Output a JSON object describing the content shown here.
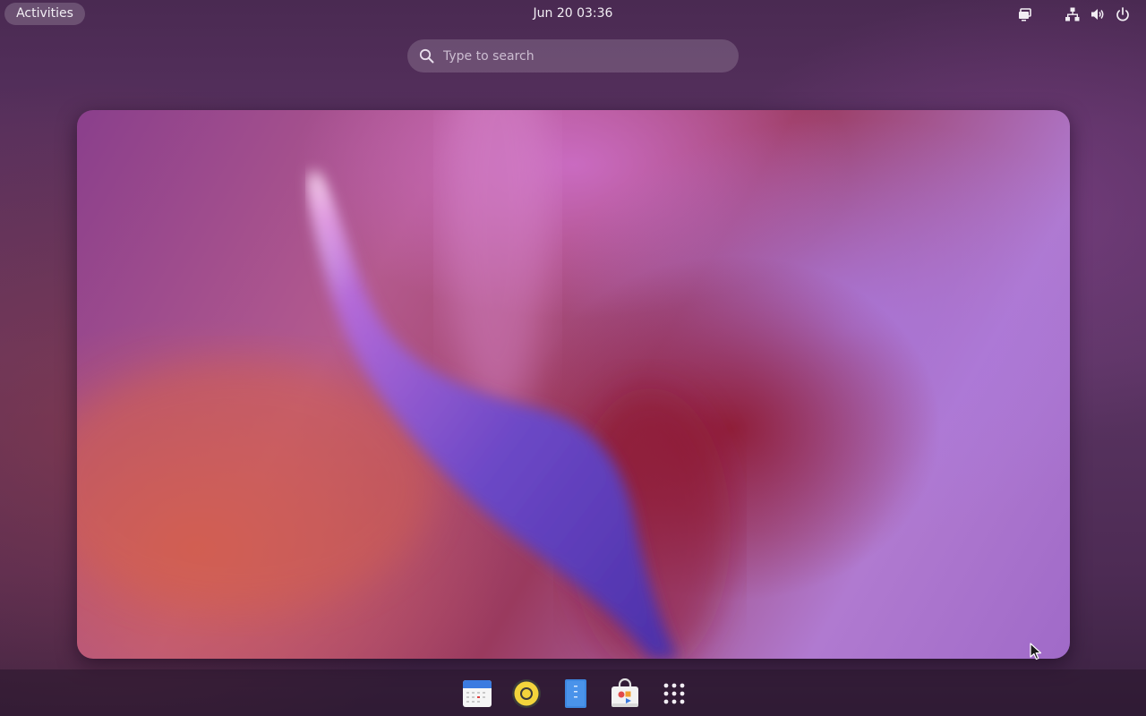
{
  "top_bar": {
    "activities_label": "Activities",
    "clock": "Jun 20  03:36",
    "tray": [
      {
        "name": "screen-share-icon"
      },
      {
        "name": "network-icon"
      },
      {
        "name": "volume-icon"
      },
      {
        "name": "power-icon"
      }
    ]
  },
  "search": {
    "placeholder": "Type to search",
    "value": ""
  },
  "workspace": {
    "wallpaper": "purple-red abstract"
  },
  "dock": {
    "items": [
      {
        "icon": "calendar-icon",
        "app": "Calendar"
      },
      {
        "icon": "rhythmbox-icon",
        "app": "Rhythmbox"
      },
      {
        "icon": "text-editor-icon",
        "app": "Text Editor"
      },
      {
        "icon": "software-store-icon",
        "app": "Software"
      },
      {
        "icon": "show-apps-icon",
        "app": "Show Applications"
      }
    ]
  },
  "colors": {
    "accent_search_bg": "#ffffff29",
    "dock_bg": "#28162c8c",
    "text": "#f2eef4"
  }
}
